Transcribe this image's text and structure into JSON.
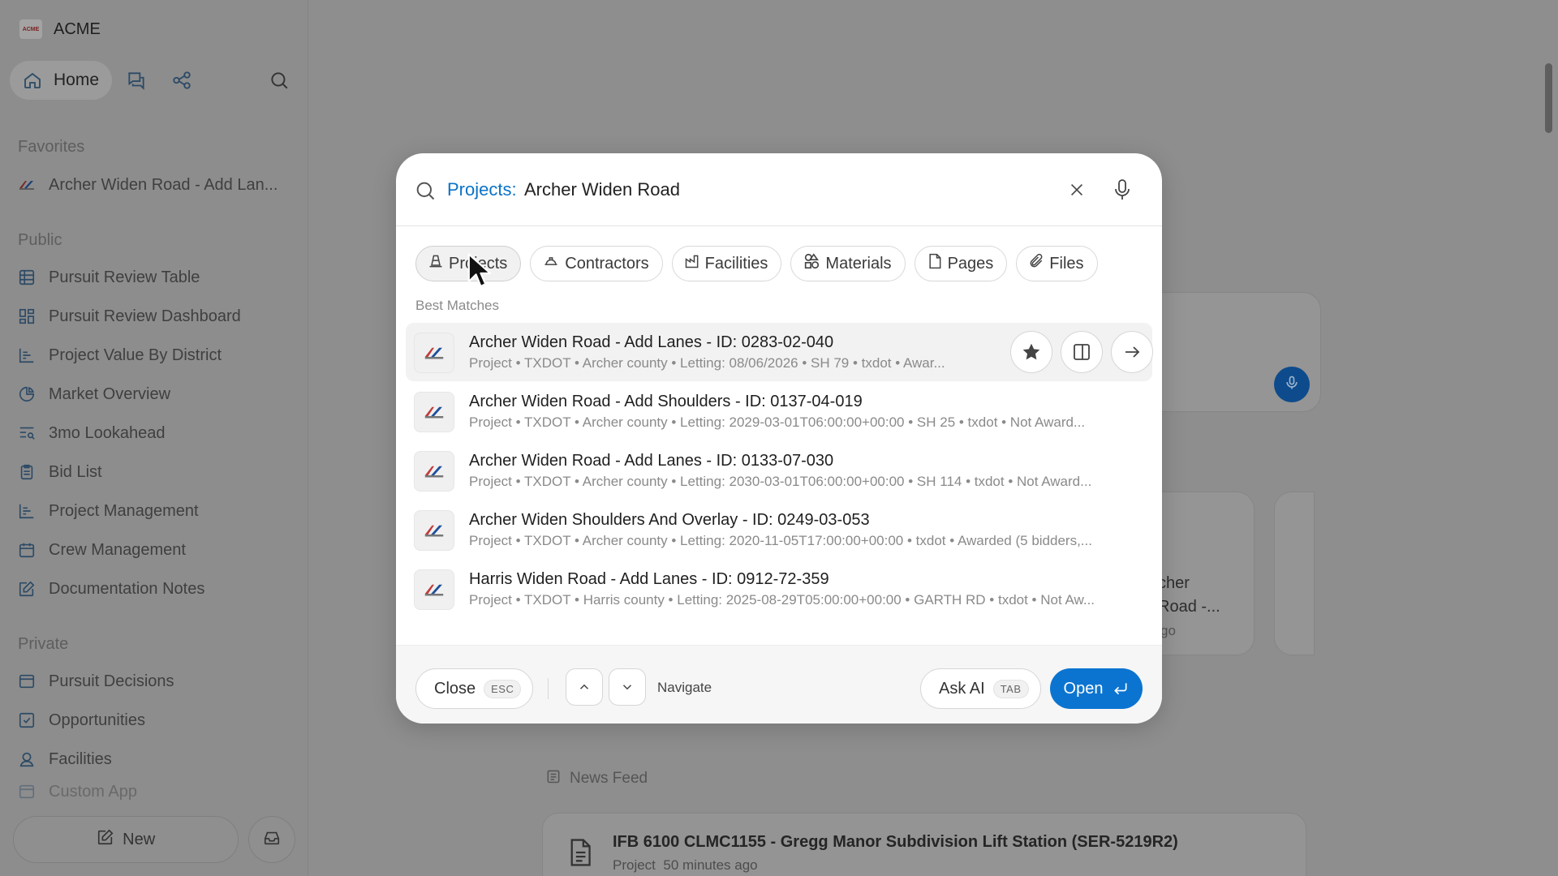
{
  "brand": {
    "name": "ACME",
    "logo_text": "ACME"
  },
  "topnav": {
    "home_label": "Home"
  },
  "sidebar": {
    "favorites_title": "Favorites",
    "favorites": [
      {
        "label": "Archer Widen Road - Add Lan...",
        "icon": "project-logo-icon"
      }
    ],
    "public_title": "Public",
    "public_items": [
      {
        "label": "Pursuit Review Table",
        "icon": "table-icon"
      },
      {
        "label": "Pursuit Review Dashboard",
        "icon": "dashboard-icon"
      },
      {
        "label": "Project Value By District",
        "icon": "bar-chart-icon"
      },
      {
        "label": "Market Overview",
        "icon": "pie-chart-icon"
      },
      {
        "label": "3mo Lookahead",
        "icon": "list-search-icon"
      },
      {
        "label": "Bid List",
        "icon": "clipboard-icon"
      },
      {
        "label": "Project Management",
        "icon": "bar-chart-icon"
      },
      {
        "label": "Crew Management",
        "icon": "calendar-icon"
      },
      {
        "label": "Documentation Notes",
        "icon": "edit-note-icon"
      }
    ],
    "private_title": "Private",
    "private_items": [
      {
        "label": "Pursuit Decisions",
        "icon": "window-icon"
      },
      {
        "label": "Opportunities",
        "icon": "checkbox-icon"
      },
      {
        "label": "Facilities",
        "icon": "user-pin-icon"
      },
      {
        "label": "Custom App",
        "icon": "app-icon"
      }
    ],
    "new_button": "New"
  },
  "background": {
    "news_feed_label": "News Feed",
    "feed_title": "IFB 6100 CLMC1155 - Gregg Manor Subdivision Lift Station (SER-5219R2)",
    "feed_sub_type": "Project",
    "feed_sub_time": "50 minutes ago",
    "partial_card_lines": [
      "cher",
      "Road -...",
      "go"
    ]
  },
  "search": {
    "prefix": "Projects:",
    "query": "Archer Widen Road"
  },
  "chips": [
    {
      "label": "Projects",
      "icon": "cone-icon",
      "active": true
    },
    {
      "label": "Contractors",
      "icon": "hardhat-icon",
      "active": false
    },
    {
      "label": "Facilities",
      "icon": "factory-icon",
      "active": false
    },
    {
      "label": "Materials",
      "icon": "shapes-icon",
      "active": false
    },
    {
      "label": "Pages",
      "icon": "page-icon",
      "active": false
    },
    {
      "label": "Files",
      "icon": "paperclip-icon",
      "active": false
    }
  ],
  "best_matches_label": "Best Matches",
  "results": [
    {
      "title": "Archer Widen Road - Add Lanes - ID: 0283-02-040",
      "subtitle": "Project • TXDOT • Archer county • Letting: 08/06/2026 • SH 79 • txdot • Awar...",
      "selected": true
    },
    {
      "title": "Archer Widen Road - Add Shoulders - ID: 0137-04-019",
      "subtitle": "Project • TXDOT • Archer county • Letting: 2029-03-01T06:00:00+00:00 • SH 25 • txdot • Not Award...",
      "selected": false
    },
    {
      "title": "Archer Widen Road - Add Lanes - ID: 0133-07-030",
      "subtitle": "Project • TXDOT • Archer county • Letting: 2030-03-01T06:00:00+00:00 • SH 114 • txdot • Not Award...",
      "selected": false
    },
    {
      "title": "Archer Widen Shoulders And Overlay - ID: 0249-03-053",
      "subtitle": "Project • TXDOT • Archer county • Letting: 2020-11-05T17:00:00+00:00 • txdot • Awarded (5 bidders,...",
      "selected": false
    },
    {
      "title": "Harris Widen Road - Add Lanes - ID: 0912-72-359",
      "subtitle": "Project • TXDOT • Harris county • Letting: 2025-08-29T05:00:00+00:00 • GARTH RD • txdot • Not Aw...",
      "selected": false
    }
  ],
  "footer": {
    "close_label": "Close",
    "close_key": "ESC",
    "navigate_label": "Navigate",
    "ask_ai_label": "Ask AI",
    "ask_ai_key": "TAB",
    "open_label": "Open"
  },
  "colors": {
    "accent": "#0b74d0",
    "prefix": "#0a73c8",
    "overlay": "#8e8e8e"
  }
}
